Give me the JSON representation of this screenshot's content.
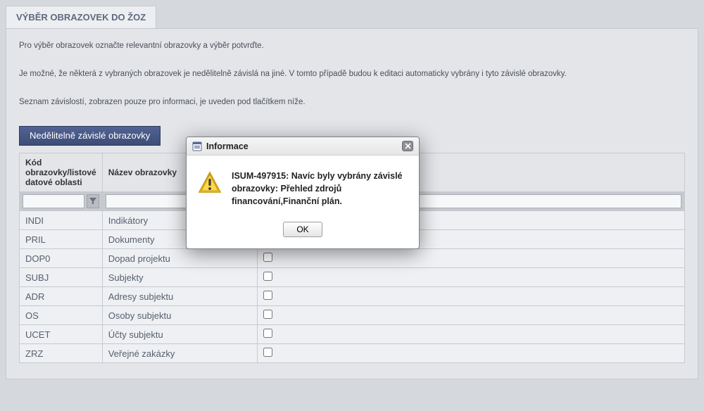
{
  "tab_title": "VÝBĚR OBRAZOVEK DO ŽOZ",
  "paragraphs": {
    "p1": "Pro výběr obrazovek označte relevantní obrazovky a výběr potvrďte.",
    "p2": "Je možné, že některá z vybraných obrazovek je nedělitelně závislá na jiné. V tomto případě budou k editaci automaticky vybrány i tyto závislé obrazovky.",
    "p3": "Seznam závislostí, zobrazen pouze pro informaci, je uveden pod tlačítkem níže."
  },
  "button_label": "Nedělitelně závislé obrazovky",
  "columns": {
    "code": "Kód obrazovky/listové datové oblasti",
    "name": "Název obrazovky"
  },
  "rows": [
    {
      "code": "INDI",
      "name": "Indikátory"
    },
    {
      "code": "PRIL",
      "name": "Dokumenty"
    },
    {
      "code": "DOP0",
      "name": "Dopad projektu"
    },
    {
      "code": "SUBJ",
      "name": "Subjekty"
    },
    {
      "code": "ADR",
      "name": "Adresy subjektu"
    },
    {
      "code": "OS",
      "name": "Osoby subjektu"
    },
    {
      "code": "UCET",
      "name": "Účty subjektu"
    },
    {
      "code": "ZRZ",
      "name": "Veřejné zakázky"
    }
  ],
  "modal": {
    "title": "Informace",
    "message": "ISUM-497915: Navíc byly vybrány závislé obrazovky: Přehled zdrojů financování,Finanční plán.",
    "ok": "OK"
  }
}
